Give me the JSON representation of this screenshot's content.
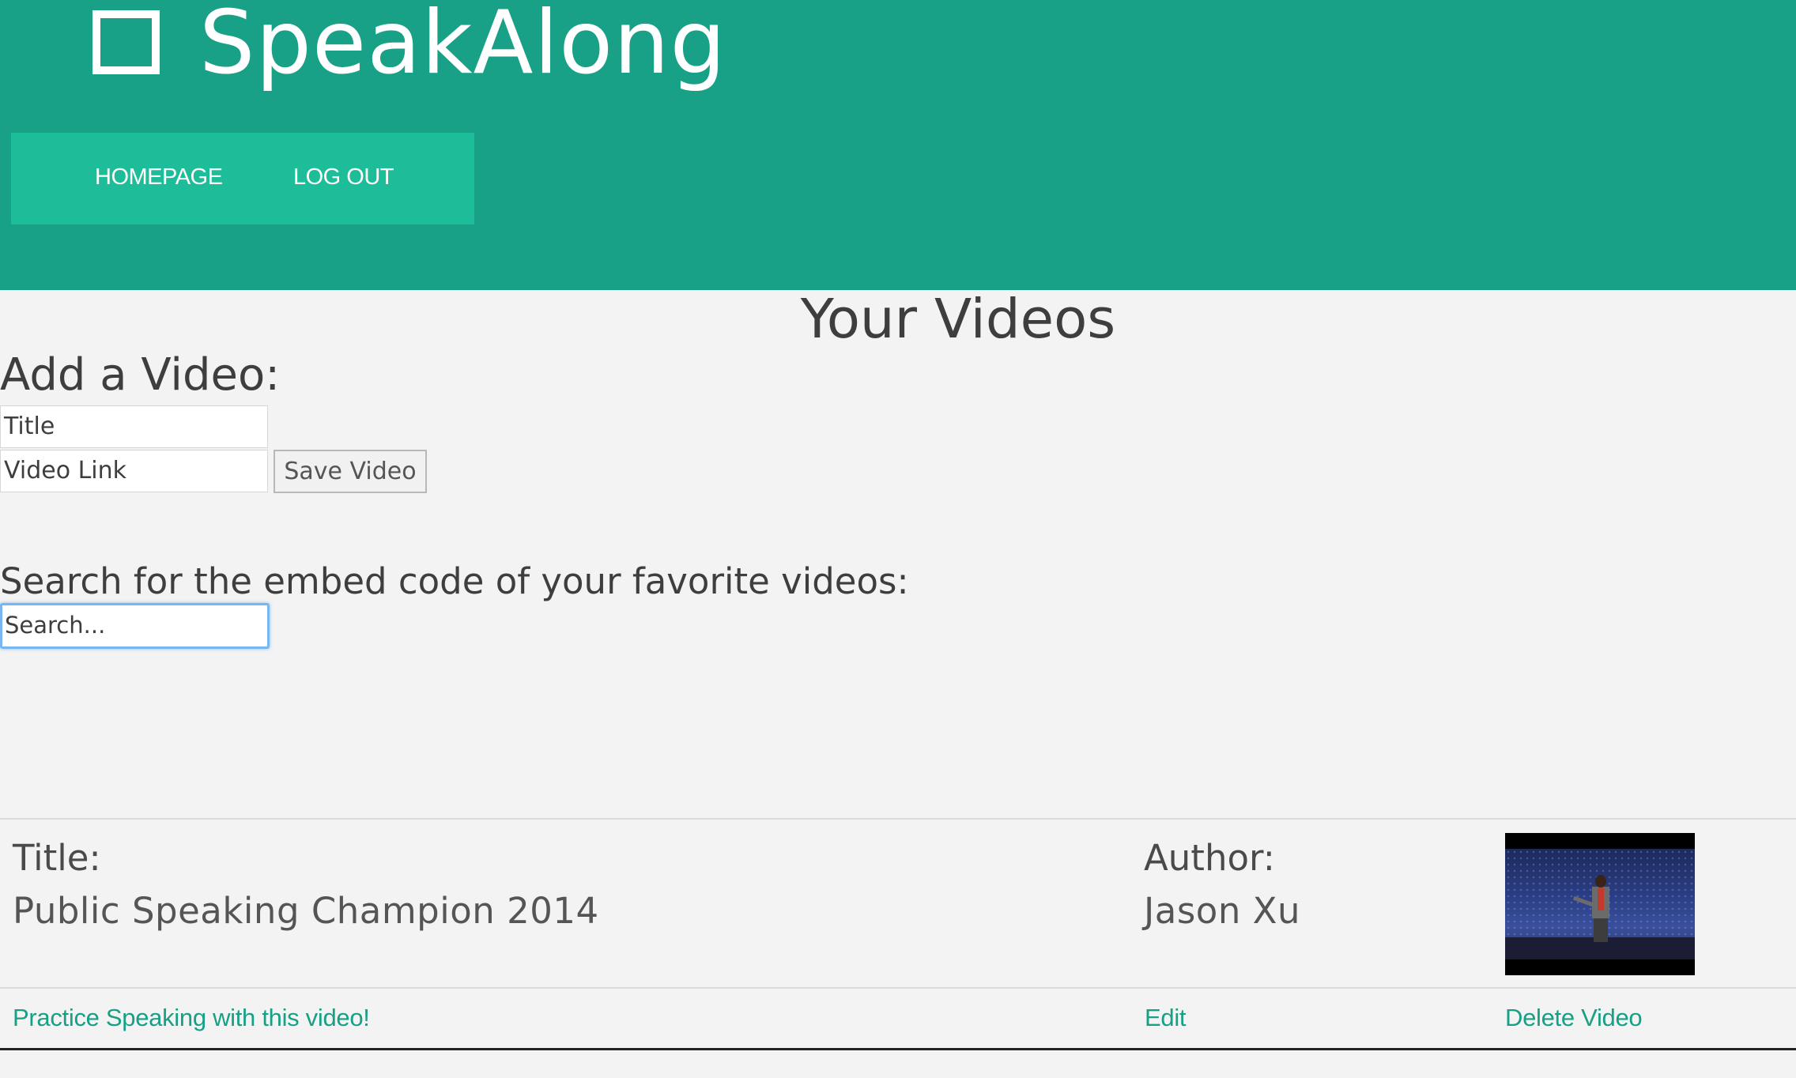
{
  "app": {
    "brand": "SpeakAlong",
    "logo_icon": "square-outline-icon",
    "colors": {
      "header": "#18a187",
      "nav": "#1cbd98",
      "link": "#16a085",
      "background": "#f3f3f3"
    }
  },
  "nav": {
    "items": [
      {
        "label": "HOMEPAGE"
      },
      {
        "label": "LOG OUT"
      }
    ]
  },
  "page": {
    "title": "Your Videos"
  },
  "add_video": {
    "heading": "Add a Video:",
    "title_placeholder": "Title",
    "link_placeholder": "Video Link",
    "save_label": "Save Video"
  },
  "search": {
    "heading": "Search for the embed code of your favorite videos:",
    "placeholder": "Search..."
  },
  "video": {
    "title_label": "Title:",
    "title": "Public Speaking Champion 2014",
    "author_label": "Author:",
    "author": "Jason Xu",
    "thumbnail": "speaker-on-stage-thumbnail",
    "actions": {
      "practice": "Practice Speaking with this video!",
      "edit": "Edit",
      "delete": "Delete Video"
    }
  }
}
